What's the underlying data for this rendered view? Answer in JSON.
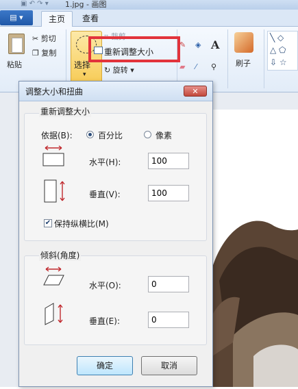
{
  "window": {
    "title": "1.jpg - 画图"
  },
  "tabs": {
    "file": "▾",
    "home": "主页",
    "view": "查看"
  },
  "ribbon": {
    "paste": "粘贴",
    "cut": "剪切",
    "copy": "复制",
    "select": "选择",
    "crop": "裁剪",
    "resize": "重新调整大小",
    "rotate": "旋转",
    "brushes": "刷子"
  },
  "dialog": {
    "title": "调整大小和扭曲",
    "close": "✕",
    "resize_group": {
      "title": "重新调整大小",
      "by_label": "依据(B):",
      "percent_label": "百分比",
      "pixels_label": "像素",
      "selected": "percent",
      "horizontal_label": "水平(H):",
      "horizontal_value": "100",
      "vertical_label": "垂直(V):",
      "vertical_value": "100",
      "keep_ratio_label": "保持纵横比(M)",
      "keep_ratio_checked": true
    },
    "skew_group": {
      "title": "倾斜(角度)",
      "horizontal_label": "水平(O):",
      "horizontal_value": "0",
      "vertical_label": "垂直(E):",
      "vertical_value": "0"
    },
    "ok_label": "确定",
    "cancel_label": "取消"
  },
  "colors": {
    "highlight": "#e2333b",
    "accent": "#1f58a8"
  }
}
